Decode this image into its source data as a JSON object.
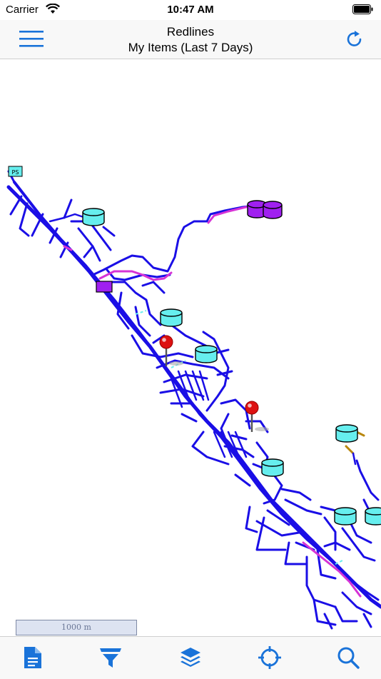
{
  "status_bar": {
    "carrier": "Carrier",
    "time": "10:47 AM",
    "wifi_icon": "wifi-icon",
    "battery_icon": "battery-icon"
  },
  "nav_bar": {
    "title": "Redlines",
    "subtitle": "My Items (Last 7 Days)",
    "menu_icon": "hamburger-menu-icon",
    "refresh_icon": "refresh-icon",
    "accent_color": "#1a73d9"
  },
  "map": {
    "labels": {
      "station_label": "PS"
    },
    "colors": {
      "network": "#1a0ee6",
      "redline": "#d633d6",
      "tank": "#66eeee",
      "purple_tank": "#a020f0",
      "pin": "#dd1111"
    },
    "scale_text": "1000 m"
  },
  "tab_bar": {
    "items": [
      {
        "icon": "document-icon"
      },
      {
        "icon": "filter-icon"
      },
      {
        "icon": "layers-icon"
      },
      {
        "icon": "locate-icon"
      },
      {
        "icon": "search-icon"
      }
    ]
  }
}
